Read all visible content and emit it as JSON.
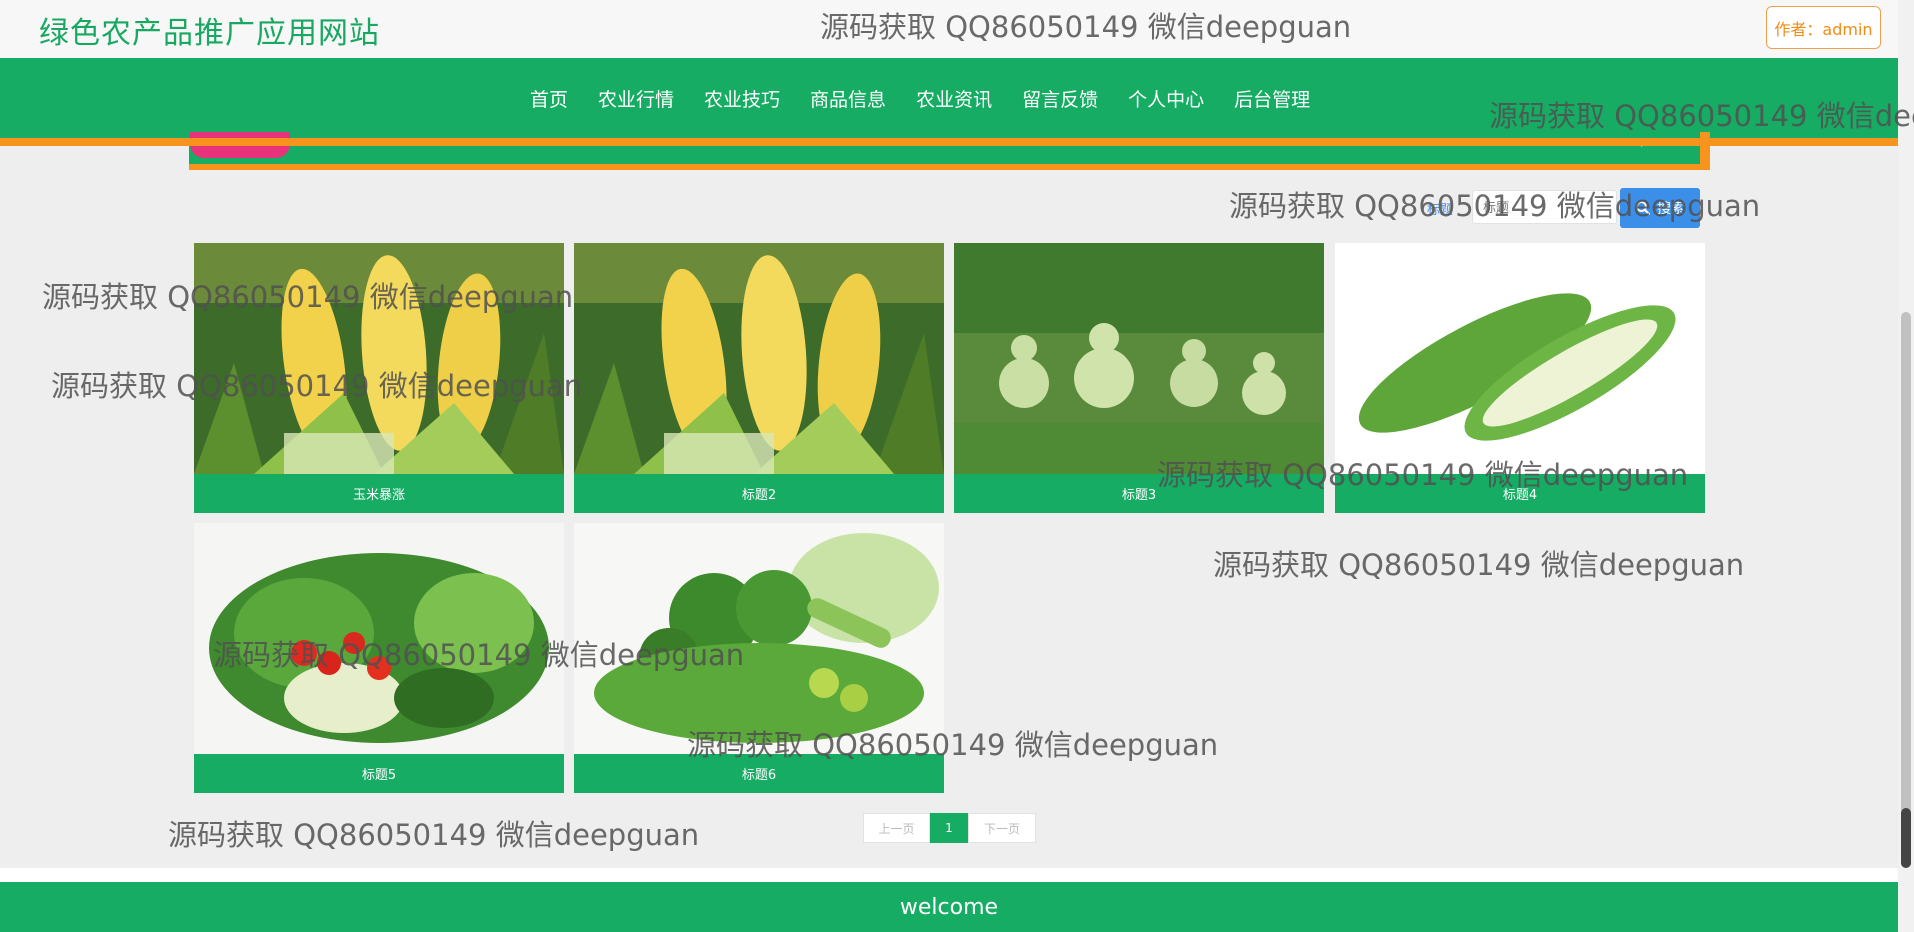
{
  "header": {
    "site_title": "绿色农产品推广应用网站",
    "author_label": "作者：admin"
  },
  "nav": {
    "items": [
      "首页",
      "农业行情",
      "农业技巧",
      "商品信息",
      "农业资讯",
      "留言反馈",
      "个人中心",
      "后台管理"
    ]
  },
  "search": {
    "label": "标题",
    "placeholder": "标题",
    "button_label": "搜索"
  },
  "products": [
    {
      "title": "玉米暴涨",
      "image": "corn"
    },
    {
      "title": "标题2",
      "image": "corn"
    },
    {
      "title": "标题3",
      "image": "gourds"
    },
    {
      "title": "标题4",
      "image": "bitter-melon"
    },
    {
      "title": "标题5",
      "image": "vegetable-basket"
    },
    {
      "title": "标题6",
      "image": "green-vegetables"
    }
  ],
  "pager": {
    "prev": "上一页",
    "current": "1",
    "next": "下一页"
  },
  "footer": {
    "text": "welcome"
  },
  "watermark": "源码获取 QQ86050149 微信deepguan",
  "colors": {
    "brand_green": "#17ac64",
    "accent_orange": "#f7941d",
    "search_blue": "#3b8fe8"
  }
}
